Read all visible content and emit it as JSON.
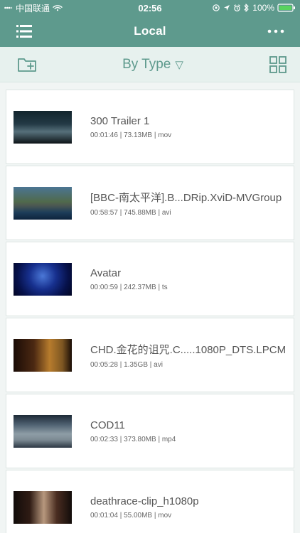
{
  "status": {
    "carrier": "中国联通",
    "time": "02:56",
    "battery": "100%"
  },
  "header": {
    "title": "Local"
  },
  "toolbar": {
    "sort_label": "By Type",
    "sort_triangle": "▽"
  },
  "items": [
    {
      "title": "300 Trailer 1",
      "details": "00:01:46 | 73.13MB | mov"
    },
    {
      "title": "[BBC-南太平洋].B...DRip.XviD-MVGroup",
      "details": "00:58:57 | 745.88MB | avi"
    },
    {
      "title": "Avatar",
      "details": "00:00:59 | 242.37MB | ts"
    },
    {
      "title": "CHD.金花的诅咒.C.....1080P_DTS.LPCM",
      "details": "00:05:28 | 1.35GB | avi"
    },
    {
      "title": "COD11",
      "details": "00:02:33 | 373.80MB | mp4"
    },
    {
      "title": "deathrace-clip_h1080p",
      "details": "00:01:04 | 55.00MB | mov"
    }
  ],
  "colors": {
    "header_bg": "#5e9a8d",
    "toolbar_bg": "#e7f1ee",
    "accent": "#5e9a8d"
  },
  "icons": {
    "menu": "menu-list-icon",
    "more": "more-dots-icon",
    "new_folder": "folder-plus-icon",
    "grid": "grid-view-icon",
    "wifi": "wifi-icon",
    "battery": "battery-icon",
    "signal": "signal-icon",
    "location": "location-icon",
    "alarm": "alarm-icon",
    "bluetooth": "bluetooth-icon",
    "orientation": "orientation-lock-icon"
  }
}
